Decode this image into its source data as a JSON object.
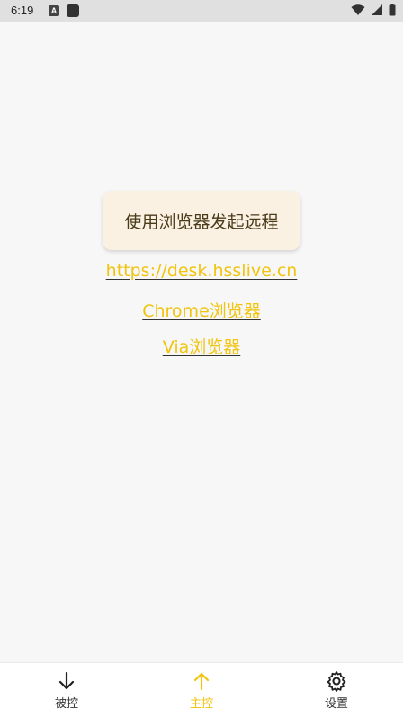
{
  "status_bar": {
    "time": "6:19",
    "icon_a": "A"
  },
  "main": {
    "card_text": "使用浏览器发起远程",
    "links": [
      "https://desk.hsslive.cn",
      "Chrome浏览器",
      "Via浏览器"
    ]
  },
  "bottom_nav": {
    "items": [
      {
        "label": "被控",
        "icon": "arrow-down-icon"
      },
      {
        "label": "主控",
        "icon": "arrow-up-icon"
      },
      {
        "label": "设置",
        "icon": "gear-icon"
      }
    ],
    "active_color": "#f1c40f"
  }
}
